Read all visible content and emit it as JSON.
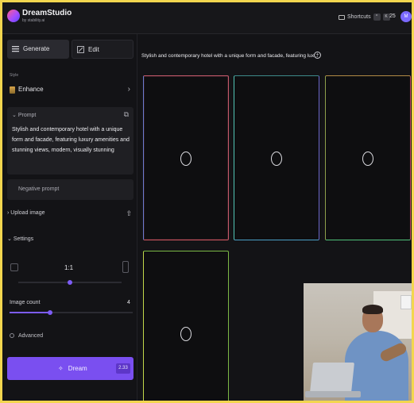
{
  "app": {
    "name": "DreamStudio",
    "byline": "by stability.ai"
  },
  "header": {
    "shortcuts_label": "Shortcuts",
    "shortcut_keys": [
      "^",
      "K"
    ],
    "credits": "25",
    "avatar_initial": "M"
  },
  "sidebar": {
    "tabs": [
      {
        "label": "Generate",
        "active": true
      },
      {
        "label": "Edit",
        "active": false
      }
    ],
    "style": {
      "label": "Style",
      "value": "Enhance"
    },
    "prompt": {
      "title": "Prompt",
      "text": "Stylish and contemporary hotel with a unique form and facade, featuring luxury amenities and stunning views, modern, visually stunning"
    },
    "negative_prompt": {
      "label": "Negative prompt"
    },
    "upload_image": {
      "label": "Upload image"
    },
    "settings": {
      "label": "Settings"
    },
    "aspect_ratio": {
      "value": "1:1",
      "position_fraction": 0.5
    },
    "image_count": {
      "label": "Image count",
      "value": "4",
      "fraction": 0.33
    },
    "advanced": {
      "label": "Advanced"
    },
    "dream_button": {
      "label": "Dream",
      "cost": "2.33"
    }
  },
  "main": {
    "prompt_heading": "Stylish and contemporary hotel with a unique form and facade, featuring lux...",
    "image_cards": [
      {
        "state": "loading"
      },
      {
        "state": "loading"
      },
      {
        "state": "loading"
      },
      {
        "state": "loading"
      }
    ]
  },
  "colors": {
    "accent": "#7a4ff0",
    "highlight_border": "#f2d64f",
    "background": "#131316"
  },
  "icons": {
    "generate": "sliders-icon",
    "edit": "edit-icon",
    "copy": "copy-icon",
    "upload": "upload-icon",
    "dream": "sparkle-icon",
    "add": "plus-circle-icon"
  }
}
